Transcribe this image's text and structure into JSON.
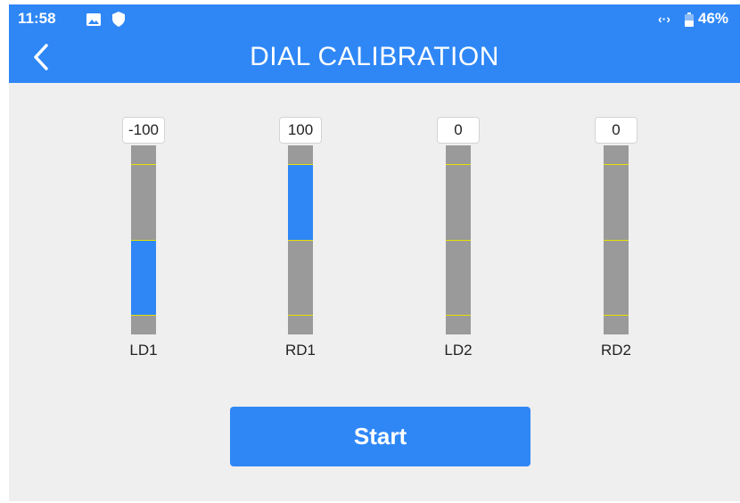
{
  "status_bar": {
    "time": "11:58",
    "battery": "46%",
    "icons": [
      "image-icon",
      "shield-icon",
      "signal-arrows-icon",
      "battery-icon"
    ]
  },
  "header": {
    "title": "DIAL CALIBRATION",
    "back_icon": "chevron-left-icon"
  },
  "dials": [
    {
      "label": "LD1",
      "value": "-100",
      "level": -100
    },
    {
      "label": "RD1",
      "value": "100",
      "level": 100
    },
    {
      "label": "LD2",
      "value": "0",
      "level": 0
    },
    {
      "label": "RD2",
      "value": "0",
      "level": 0
    }
  ],
  "start_button": {
    "label": "Start"
  },
  "colors": {
    "accent": "#2f87f6",
    "background": "#efefef",
    "bar_gray": "#9a9a9a",
    "marker": "#e8e000"
  }
}
